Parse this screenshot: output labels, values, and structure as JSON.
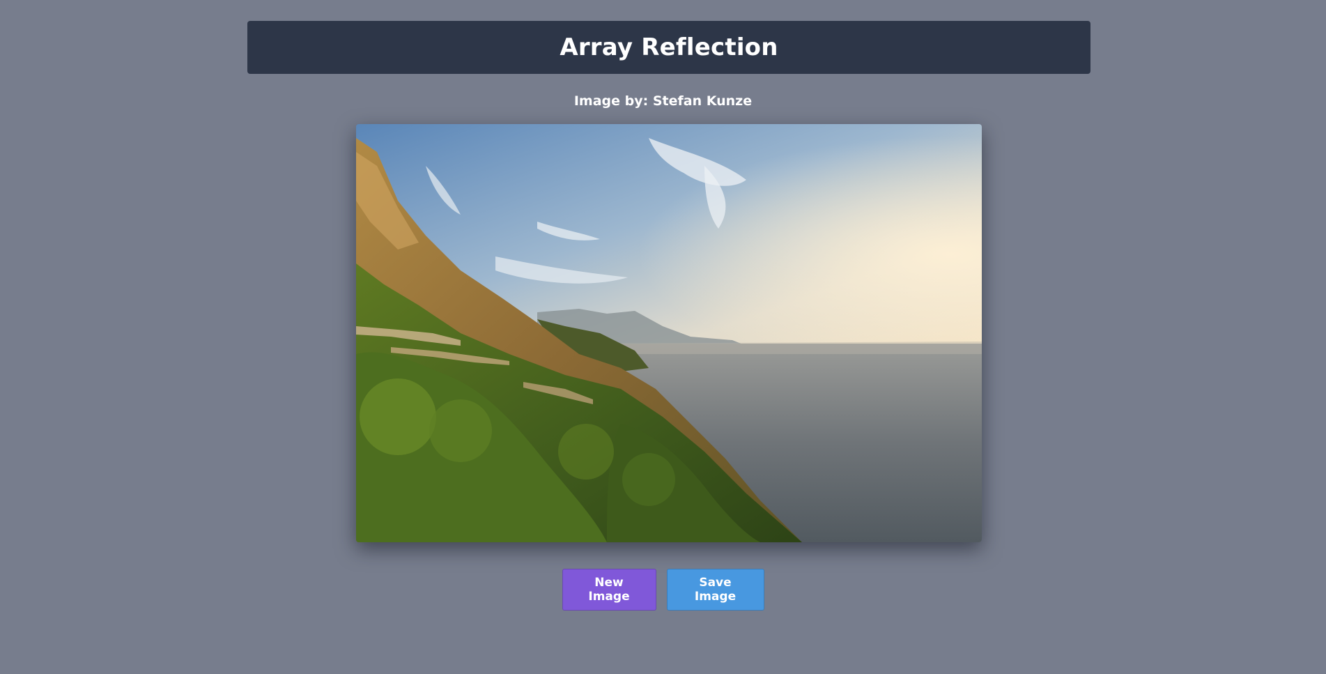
{
  "header": {
    "title": "Array Reflection"
  },
  "credit": {
    "text": "Image by: Stefan Kunze"
  },
  "image": {
    "subject": "coastal-cliffs-sunset-photo"
  },
  "actions": {
    "new_label": "New Image",
    "save_label": "Save Image"
  },
  "colors": {
    "background": "#777d8d",
    "header": "#2d3648",
    "new_button": "#8058d9",
    "save_button": "#4898e0"
  }
}
